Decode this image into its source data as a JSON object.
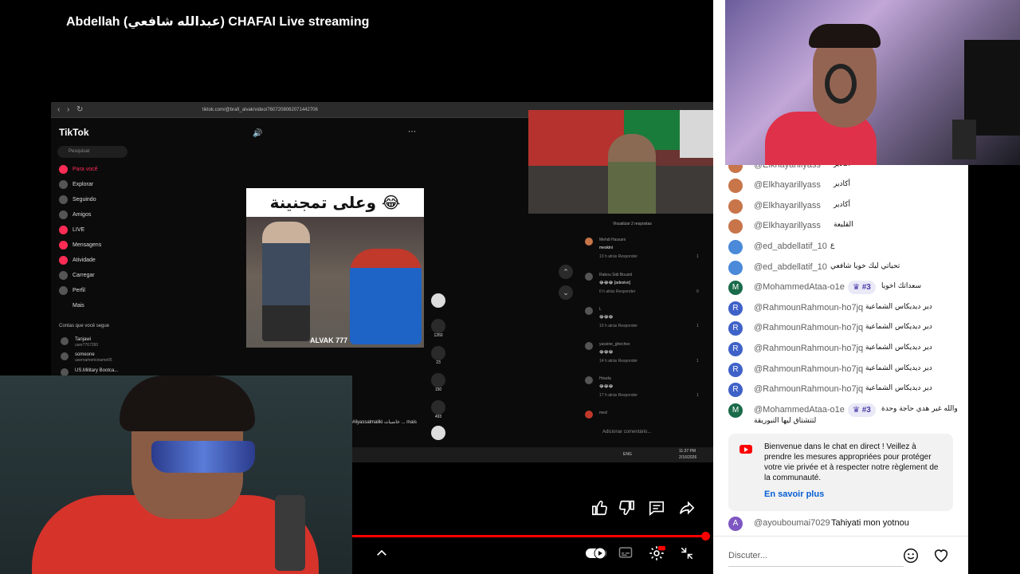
{
  "player": {
    "title": "Abdellah (عبدالله شافعي) CHAFAI Live streaming",
    "progress_fraction": 1.0
  },
  "screen": {
    "url": "tiktok.com/@brafi_alvak/video/7607208062071442706",
    "tiktok": {
      "logo": "TikTok",
      "search_placeholder": "Pesquisar",
      "nav": [
        {
          "label": "Para você",
          "icon": "home-icon",
          "active": true
        },
        {
          "label": "Explorar",
          "icon": "compass-icon"
        },
        {
          "label": "Seguindo",
          "icon": "following-icon"
        },
        {
          "label": "Amigos",
          "icon": "friends-icon"
        },
        {
          "label": "LIVE",
          "icon": "live-icon"
        },
        {
          "label": "Mensagens",
          "icon": "messages-icon"
        },
        {
          "label": "Atividade",
          "icon": "activity-icon"
        },
        {
          "label": "Carregar",
          "icon": "upload-icon"
        },
        {
          "label": "Perfil",
          "icon": "profile-icon"
        },
        {
          "label": "Mais",
          "icon": "more-icon"
        }
      ],
      "following_heading": "Contas que você segue",
      "following": [
        {
          "name": "Tanjawi",
          "sub": "user7767260"
        },
        {
          "name": "someone",
          "sub": "usernamericiname05"
        },
        {
          "name": "US.Military Bootca...",
          "sub": ""
        }
      ],
      "video_caption": "وعلى تمجنينة 😂",
      "video_watermark": "ALVAK 777",
      "side_counts": {
        "likes": "1260",
        "comments": "23",
        "saves": "150",
        "shares": "493"
      },
      "description": "#ilyassalmaliki خاسبات ... mais",
      "comments_header": "Visualizar 2 respostas",
      "comments": [
        {
          "user": "Mehdi Hassani",
          "text": "meskini",
          "meta": "13 h atrás  Responder",
          "likes": "1"
        },
        {
          "user": "Rabou Sidi Bouzid",
          "text": "😂😂😂 [adesivo]",
          "meta": "6 h atrás  Responder",
          "likes": "0"
        },
        {
          "user": "L",
          "text": "😂😂😂",
          "meta": "10 h atrás  Responder",
          "likes": "1"
        },
        {
          "user": "yassine_ghechex",
          "text": "😂😂😂",
          "meta": "14 h atrás  Responder",
          "likes": "1"
        },
        {
          "user": "Houda",
          "text": "😂😂😂",
          "meta": "17 h atrás  Responder",
          "likes": "1"
        },
        {
          "user": "med",
          "text": "",
          "meta": "",
          "likes": ""
        }
      ],
      "comment_placeholder": "Adicionar comentário...",
      "taskbar_time": "11:37 PM",
      "taskbar_date": "2/16/2026",
      "taskbar_lang": "ENG"
    }
  },
  "chat": {
    "messages": [
      {
        "avatar": "",
        "color": "orange",
        "user": "@Elkhayarillyass",
        "text": "أكادير"
      },
      {
        "avatar": "",
        "color": "orange",
        "user": "@Elkhayarillyass",
        "text": "أكادير"
      },
      {
        "avatar": "",
        "color": "orange",
        "user": "@Elkhayarillyass",
        "text": "أكادير"
      },
      {
        "avatar": "",
        "color": "orange",
        "user": "@Elkhayarillyass",
        "text": "القليعة"
      },
      {
        "avatar": "",
        "color": "blue",
        "user": "@ed_abdellatif_10",
        "text": "ع"
      },
      {
        "avatar": "",
        "color": "blue",
        "user": "@ed_abdellatif_10",
        "text": "تحياتي ليك خويا شافعي"
      },
      {
        "avatar": "M",
        "color": "green",
        "user": "@MohammedAtaa-o1e",
        "badge": "#3",
        "text": "سعداتك اخويا"
      },
      {
        "avatar": "R",
        "color": "indigo",
        "user": "@RahmounRahmoun-ho7jq",
        "text": "دير ديديكاس الشماعية"
      },
      {
        "avatar": "R",
        "color": "indigo",
        "user": "@RahmounRahmoun-ho7jq",
        "text": "دير ديديكاس الشماعية"
      },
      {
        "avatar": "R",
        "color": "indigo",
        "user": "@RahmounRahmoun-ho7jq",
        "text": "دير ديديكاس الشماعية"
      },
      {
        "avatar": "R",
        "color": "indigo",
        "user": "@RahmounRahmoun-ho7jq",
        "text": "دير ديديكاس الشماعية"
      },
      {
        "avatar": "R",
        "color": "indigo",
        "user": "@RahmounRahmoun-ho7jq",
        "text": "دير ديديكاس الشماعية"
      },
      {
        "avatar": "M",
        "color": "green",
        "user": "@MohammedAtaa-o1e",
        "badge": "#3",
        "text": "والله غير هدي حاجة وحدة",
        "text2": "لتتشتاق ليها التبوريقة"
      }
    ],
    "notice": {
      "text": "Bienvenue dans le chat en direct ! Veillez à prendre les mesures appropriées pour protéger votre vie privée et à respecter notre règlement de la communauté.",
      "link": "En savoir plus"
    },
    "last_message": {
      "avatar": "A",
      "color": "purple",
      "user": "@ayouboumai7029",
      "text": "Tahiyati mon yotnou"
    },
    "input_placeholder": "Discuter..."
  },
  "colors": {
    "progress": "#ff0000",
    "link": "#065fd4",
    "tiktok_active": "#fe2c55"
  }
}
